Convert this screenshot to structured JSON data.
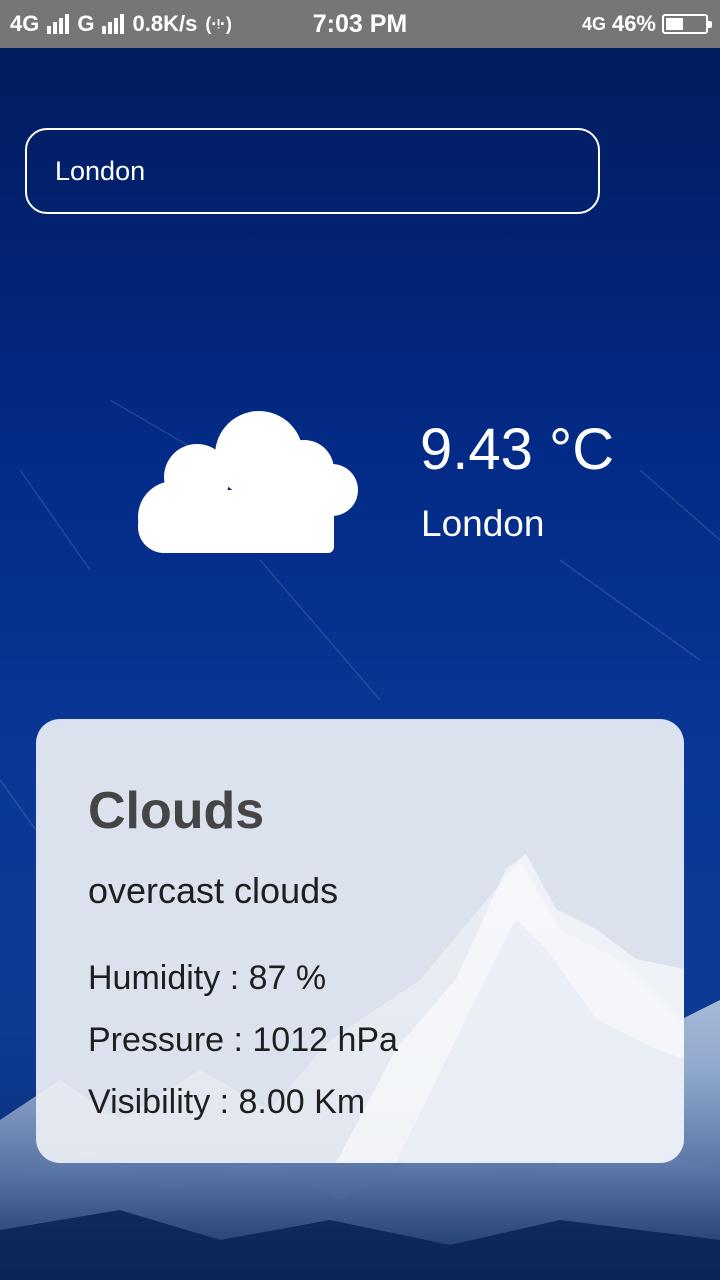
{
  "status_bar": {
    "network1": "4G",
    "network2": "G",
    "speed": "0.8K/s",
    "time": "7:03 PM",
    "network_right": "4G",
    "battery_percent": "46%",
    "battery_level": 0.46
  },
  "search": {
    "value": "London"
  },
  "weather": {
    "icon": "cloud-icon",
    "temperature": "9.43 °C",
    "city": "London"
  },
  "details": {
    "main": "Clouds",
    "description": "overcast clouds",
    "humidity": "Humidity : 87 %",
    "pressure": "Pressure : 1012 hPa",
    "visibility": "Visibility : 8.00 Km"
  },
  "colors": {
    "background": "#032a86",
    "status_bar": "#767676",
    "card": "#eceff4",
    "title_text": "#454545"
  }
}
